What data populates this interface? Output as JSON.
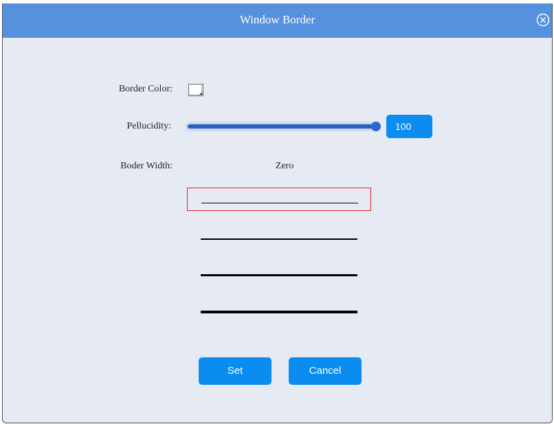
{
  "dialog": {
    "title": "Window Border",
    "close_icon": "close-circle-icon"
  },
  "border_color": {
    "label": "Border Color:",
    "value": "#ffffff"
  },
  "pellucidity": {
    "label": "Pellucidity:",
    "value": "100",
    "fraction": 1.0
  },
  "border_width": {
    "label": "Boder Width:",
    "value": "Zero",
    "options": [
      {
        "name": "zero",
        "selected": true
      },
      {
        "name": "thin",
        "selected": false
      },
      {
        "name": "medium",
        "selected": false
      },
      {
        "name": "thick",
        "selected": false
      }
    ]
  },
  "buttons": {
    "set": "Set",
    "cancel": "Cancel"
  },
  "colors": {
    "titlebar": "#5591dd",
    "accent": "#0a8cf0",
    "selection": "#e02020",
    "background": "#e6ebf3"
  }
}
